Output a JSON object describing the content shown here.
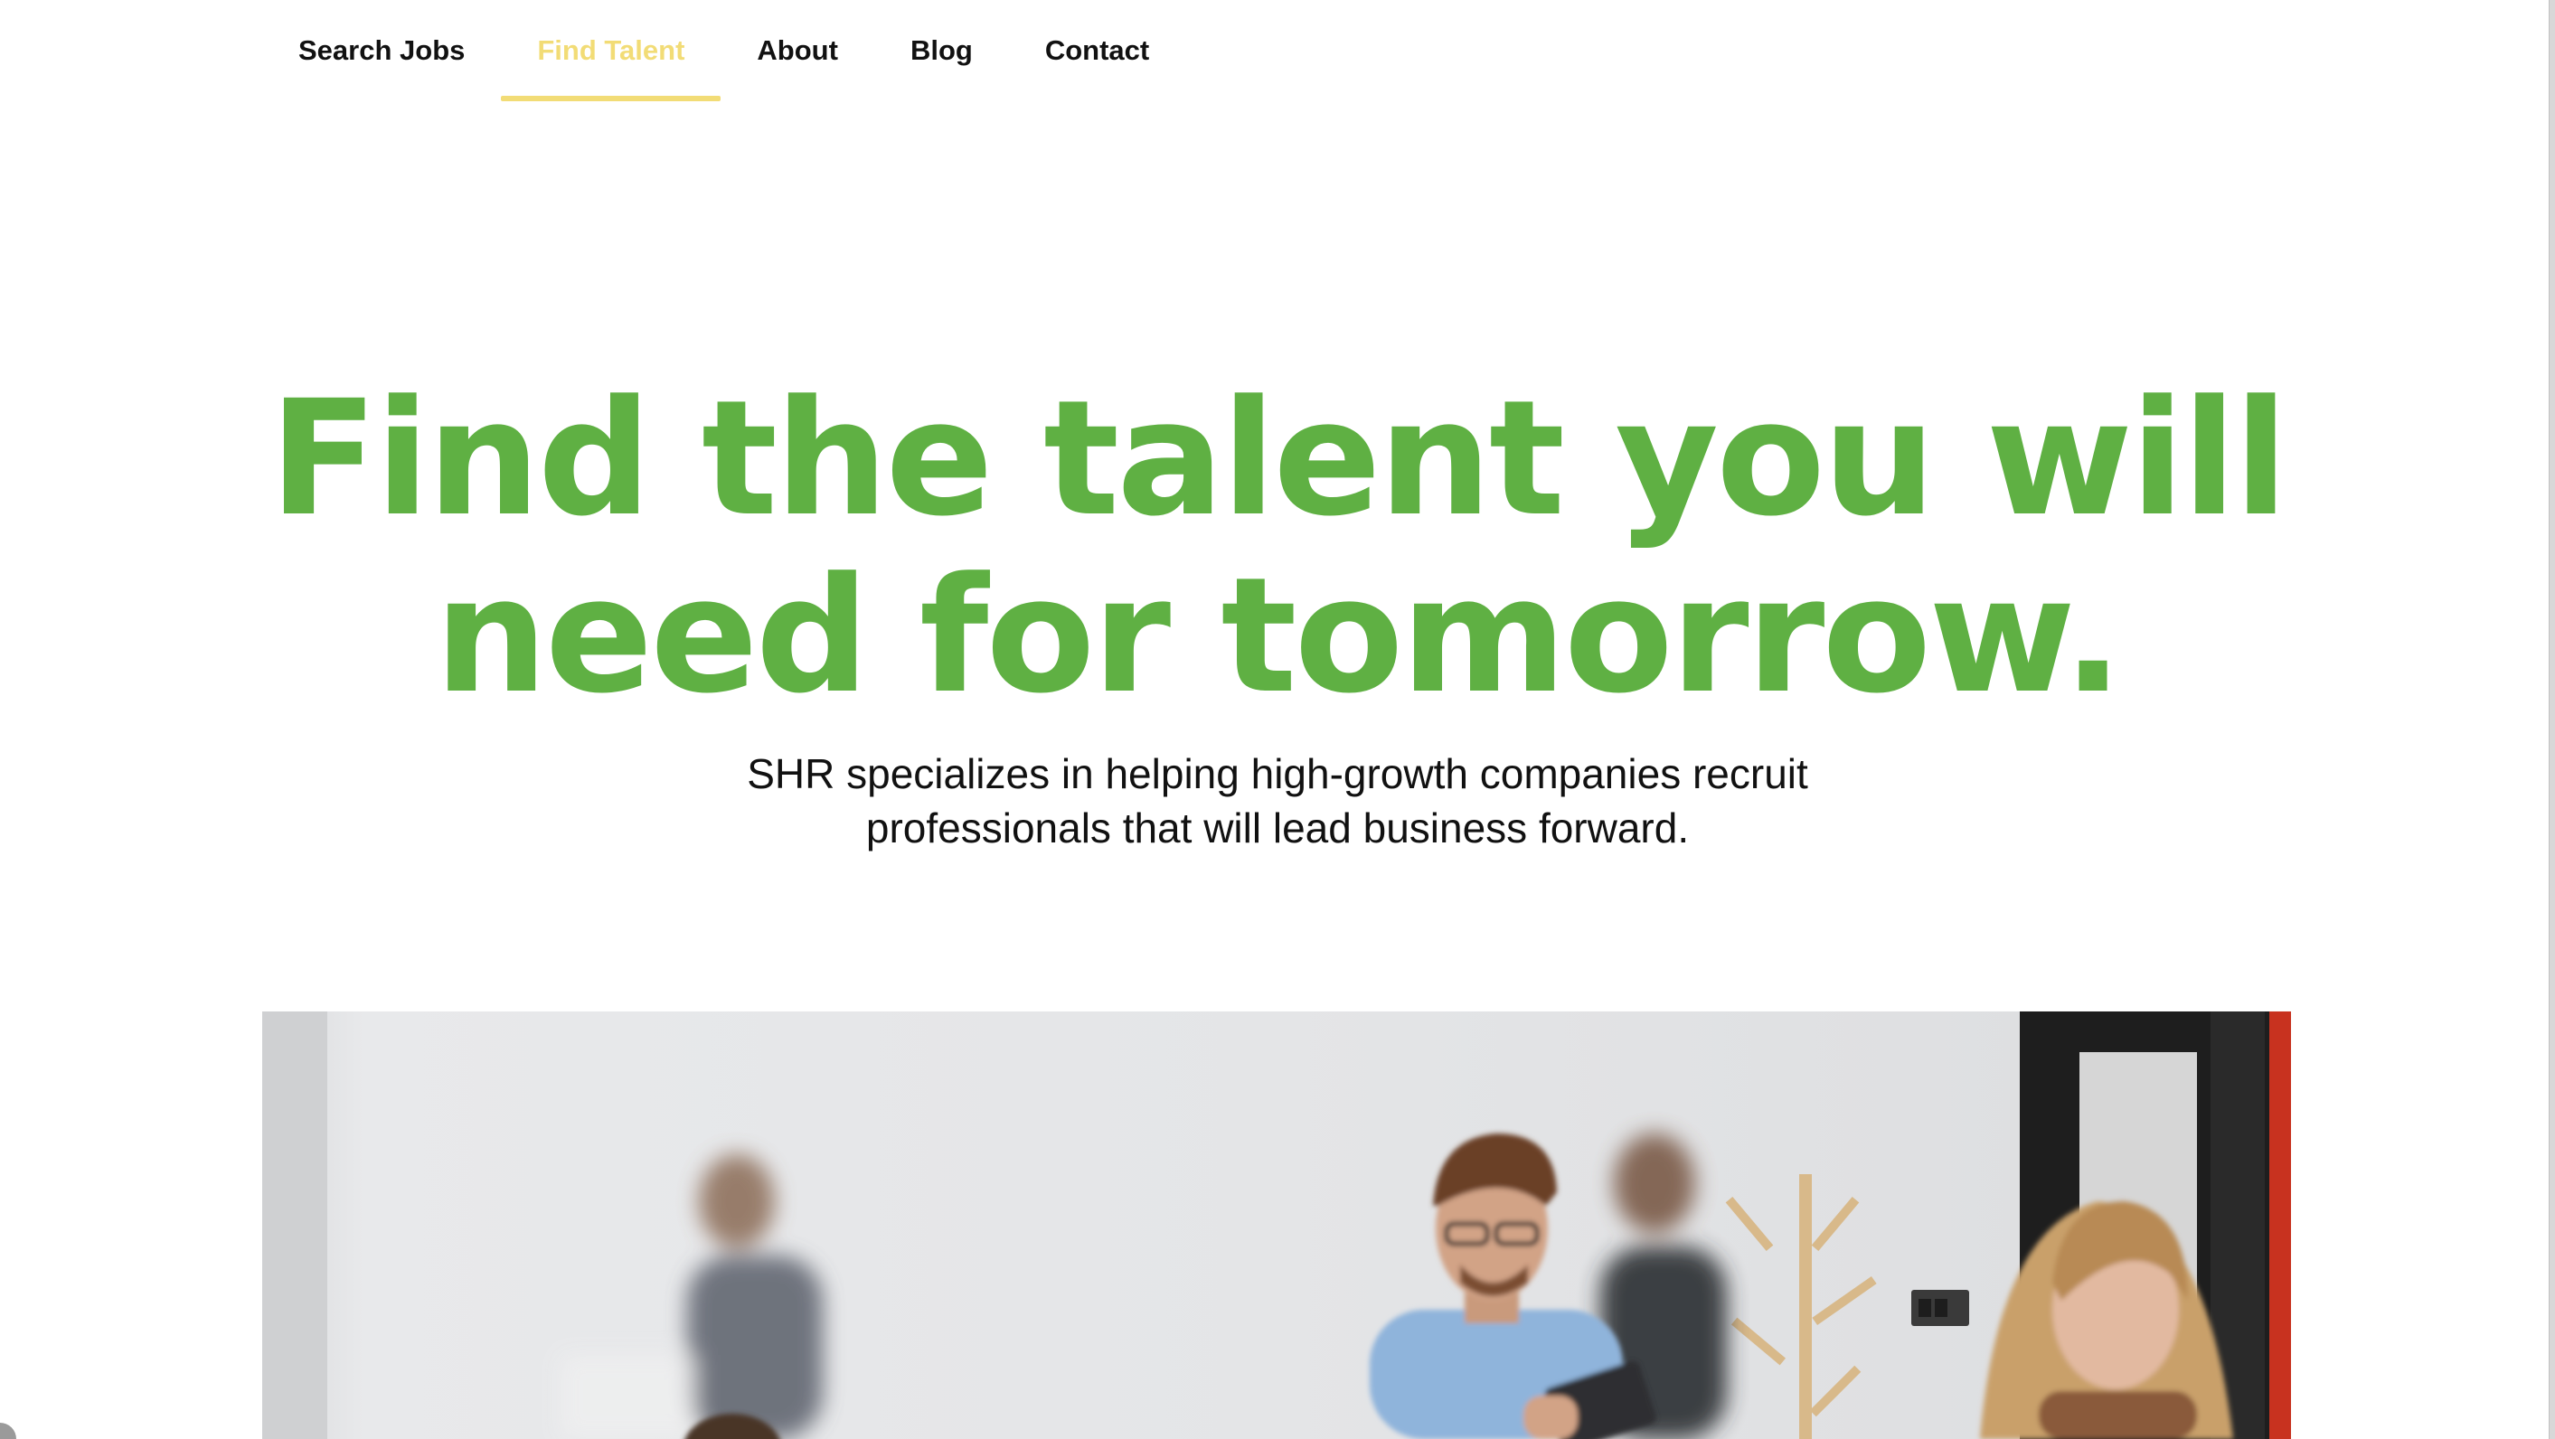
{
  "nav": {
    "items": [
      {
        "label": "Search Jobs",
        "active": false
      },
      {
        "label": "Find Talent",
        "active": true
      },
      {
        "label": "About",
        "active": false
      },
      {
        "label": "Blog",
        "active": false
      },
      {
        "label": "Contact",
        "active": false
      }
    ]
  },
  "hero": {
    "title_line1": "Find the talent you will",
    "title_line2": "need for tomorrow.",
    "subtitle_line1": "SHR specializes in helping high-growth companies recruit",
    "subtitle_line2": "professionals that will lead business forward."
  },
  "colors": {
    "accent_green": "#5fb043",
    "active_nav_yellow": "#f2dc76",
    "text_dark": "#111111"
  },
  "image": {
    "description_icon": "office-team-photo"
  }
}
